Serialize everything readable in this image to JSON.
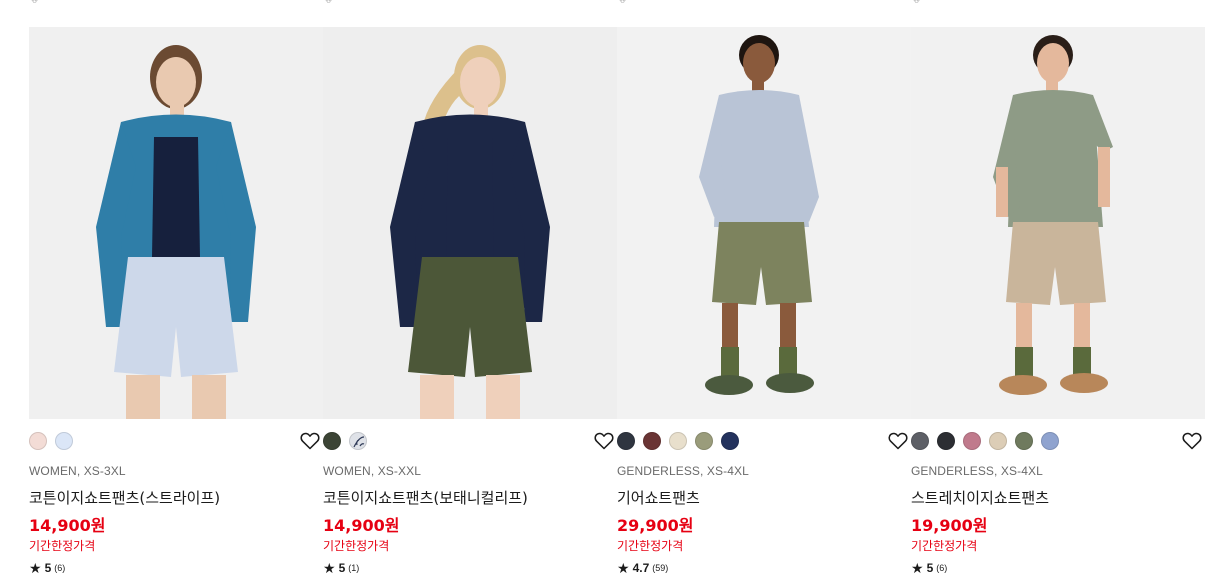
{
  "products": [
    {
      "meta": "WOMEN, XS-3XL",
      "name": "코튼이지쇼트팬츠(스트라이프)",
      "price": "14,900원",
      "promo": "기간한정가격",
      "rating": "5",
      "reviews": "(6)",
      "swatches": [
        "#f3dcd6",
        "#dbe6f7"
      ],
      "photo": {
        "skin": "#e9c9b0",
        "hair": "#6b4a32",
        "shirt": "#2f7ea8",
        "top": "#16203d",
        "shorts": "#cdd8ea",
        "bg": "#f0f0f0"
      }
    },
    {
      "meta": "WOMEN, XS-XXL",
      "name": "코튼이지쇼트팬츠(보태니컬리프)",
      "price": "14,900원",
      "promo": "기간한정가격",
      "rating": "5",
      "reviews": "(1)",
      "swatches": [
        "#3c4435",
        "#dfe2e8"
      ],
      "photo": {
        "skin": "#efd0bb",
        "hair": "#dcc08c",
        "shirt": "#1c2746",
        "top": "#1c2746",
        "shorts": "#4c5738",
        "bg": "#eeeeee"
      }
    },
    {
      "meta": "GENDERLESS, XS-4XL",
      "name": "기어쇼트팬츠",
      "price": "29,900원",
      "promo": "기간한정가격",
      "rating": "4.7",
      "reviews": "(59)",
      "swatches": [
        "#2f3540",
        "#6a3434",
        "#e8dfcc",
        "#9a9c7b",
        "#23325d"
      ],
      "photo": {
        "skin": "#8a5a3c",
        "hair": "#1e1510",
        "shirt": "#b9c4d6",
        "top": "#b9c4d6",
        "shorts": "#7d835e",
        "bg": "#f2f2f2"
      }
    },
    {
      "meta": "GENDERLESS, XS-4XL",
      "name": "스트레치이지쇼트팬츠",
      "price": "19,900원",
      "promo": "기간한정가격",
      "rating": "5",
      "reviews": "(6)",
      "swatches": [
        "#5d5f66",
        "#2c2e33",
        "#c07a8c",
        "#dccdb6",
        "#6f7a5e",
        "#8fa3cf"
      ],
      "photo": {
        "skin": "#e4b89c",
        "hair": "#2a1e18",
        "shirt": "#8e9b86",
        "top": "#8e9b86",
        "shorts": "#c9b59b",
        "bg": "#f1f1f1"
      }
    }
  ]
}
